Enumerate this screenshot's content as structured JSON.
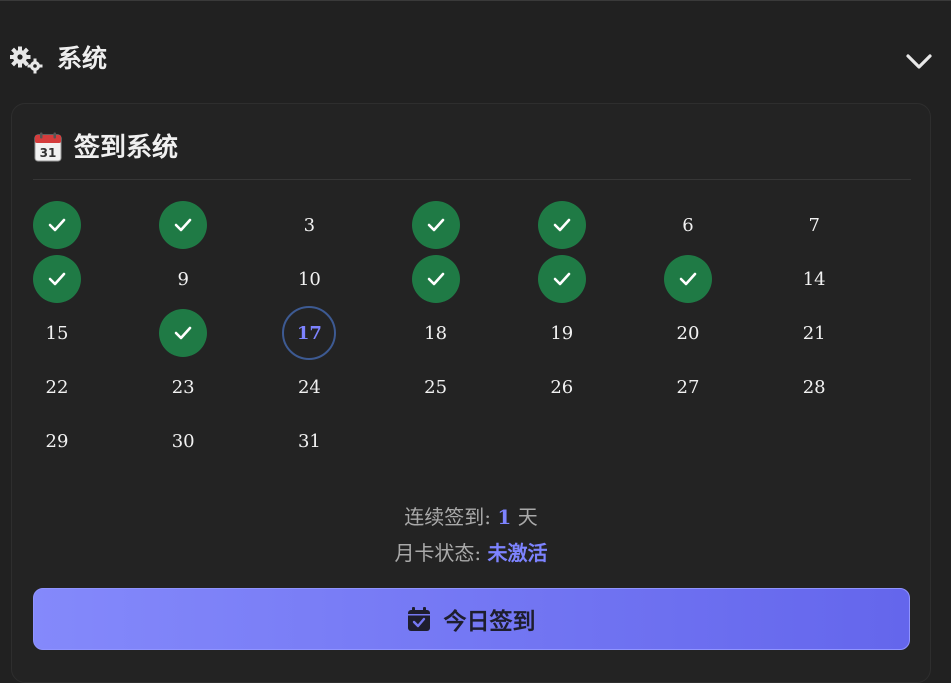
{
  "section": {
    "title": "系统",
    "icon": "gears-icon",
    "toggle_icon": "chevron-down-icon"
  },
  "card": {
    "title": "签到系统",
    "icon": "calendar-icon",
    "calendar_icon_day": "31"
  },
  "calendar": {
    "days": [
      "1",
      "2",
      "3",
      "4",
      "5",
      "6",
      "7",
      "8",
      "9",
      "10",
      "11",
      "12",
      "13",
      "14",
      "15",
      "16",
      "17",
      "18",
      "19",
      "20",
      "21",
      "22",
      "23",
      "24",
      "25",
      "26",
      "27",
      "28",
      "29",
      "30",
      "31"
    ],
    "checked_days": [
      1,
      2,
      4,
      5,
      8,
      11,
      12,
      13,
      16
    ],
    "today": 17
  },
  "stats": {
    "streak_label": "连续签到:",
    "streak_value": "1",
    "streak_unit": "天",
    "month_card_label": "月卡状态:",
    "month_card_value": "未激活"
  },
  "button": {
    "label": "今日签到",
    "icon": "calendar-check-icon"
  },
  "colors": {
    "background": "#212121",
    "checked": "#1f7a45",
    "accent": "#7d83ff",
    "button_start": "#8489fb",
    "button_end": "#6466ec"
  }
}
